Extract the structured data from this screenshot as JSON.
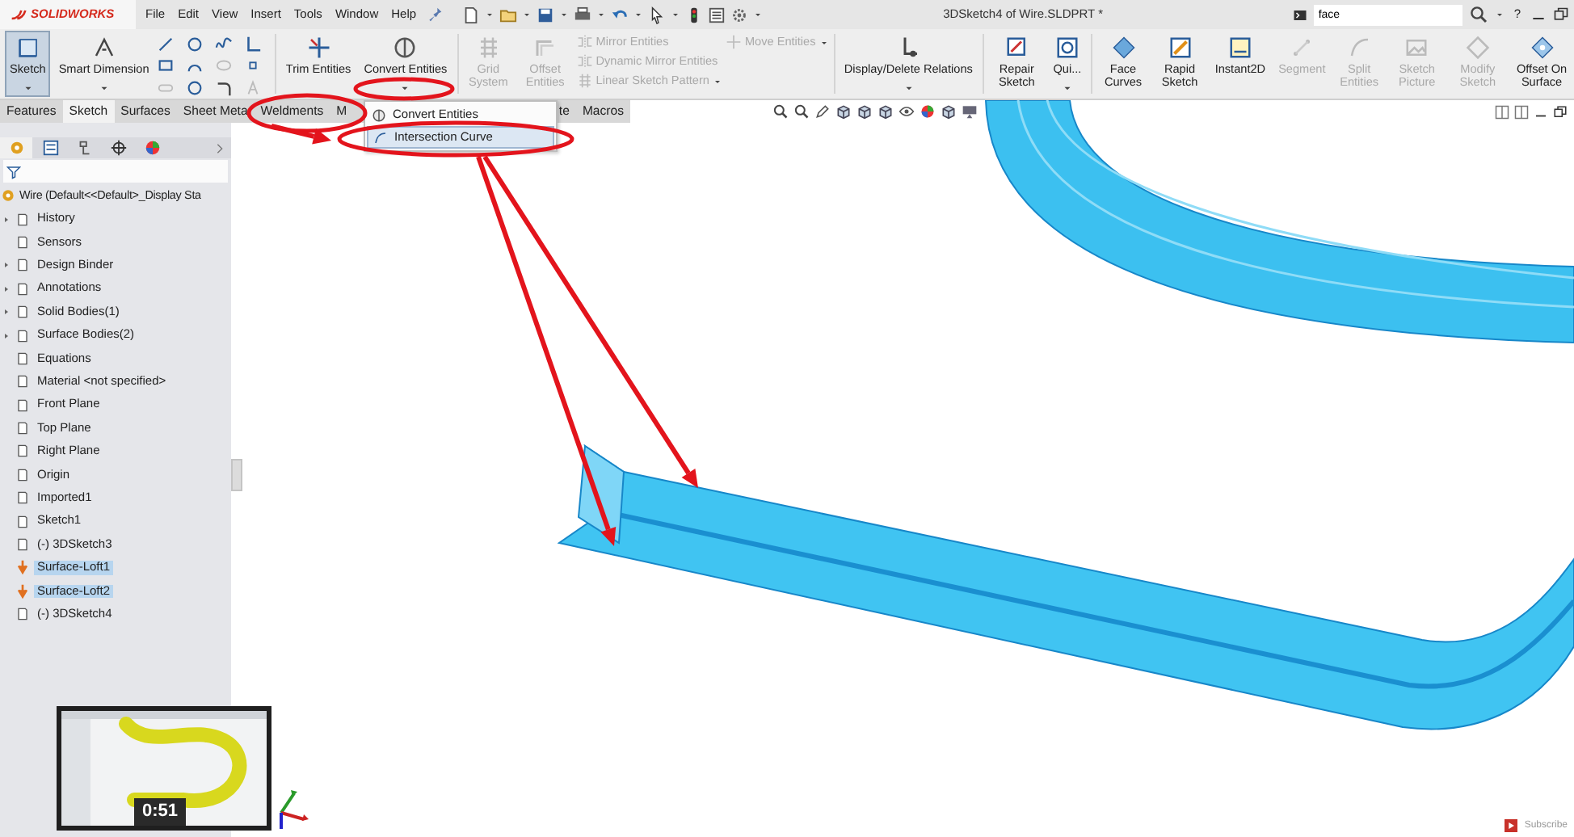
{
  "title_bar": {
    "logo": "SOLIDWORKS",
    "menu": [
      {
        "label": "File"
      },
      {
        "label": "Edit"
      },
      {
        "label": "View"
      },
      {
        "label": "Insert"
      },
      {
        "label": "Tools"
      },
      {
        "label": "Window"
      },
      {
        "label": "Help"
      }
    ],
    "document_title": "3DSketch4 of Wire.SLDPRT *",
    "search": {
      "value": "face"
    },
    "help": "?"
  },
  "ribbon": [
    {
      "kind": "wide",
      "label": "Sketch",
      "selected": true,
      "disabled": false,
      "dropdown": true
    },
    {
      "kind": "wide",
      "label": "Smart Dimension",
      "selected": false,
      "disabled": false,
      "dropdown": true
    },
    {
      "kind": "icons"
    },
    {
      "kind": "wide",
      "label": "Trim Entities",
      "selected": false,
      "disabled": false,
      "dropdown": false
    },
    {
      "kind": "wide",
      "label": "Convert Entities",
      "selected": false,
      "disabled": false,
      "dropdown": true
    },
    {
      "kind": "narrow",
      "label": "Grid System",
      "selected": false,
      "disabled": true,
      "dropdown": false
    },
    {
      "kind": "narrow",
      "label": "Offset Entities",
      "selected": false,
      "disabled": true,
      "dropdown": false
    },
    {
      "kind": "stack",
      "entries": [
        {
          "label": "Mirror Entities",
          "disabled": true
        },
        {
          "label": "Dynamic Mirror Entities",
          "disabled": true
        },
        {
          "label": "Linear Sketch Pattern",
          "disabled": true
        }
      ]
    },
    {
      "kind": "stack",
      "entries": [
        {
          "label": "Move Entities",
          "disabled": true
        }
      ]
    },
    {
      "kind": "wide",
      "label": "Display/Delete Relations",
      "selected": false,
      "disabled": false,
      "dropdown": true
    },
    {
      "kind": "narrow",
      "label": "Repair Sketch",
      "selected": false,
      "disabled": false,
      "dropdown": false
    },
    {
      "kind": "narrow",
      "label": "Qui...",
      "selected": false,
      "disabled": false,
      "dropdown": true
    },
    {
      "kind": "narrow",
      "label": "Face Curves",
      "selected": false,
      "disabled": false,
      "dropdown": false
    },
    {
      "kind": "narrow",
      "label": "Rapid Sketch",
      "selected": false,
      "disabled": false,
      "dropdown": false
    },
    {
      "kind": "narrow",
      "label": "Instant2D",
      "selected": false,
      "disabled": false,
      "dropdown": false
    },
    {
      "kind": "narrow",
      "label": "Segment",
      "selected": false,
      "disabled": true,
      "dropdown": false
    },
    {
      "kind": "narrow",
      "label": "Split Entities",
      "selected": false,
      "disabled": true,
      "dropdown": false
    },
    {
      "kind": "narrow",
      "label": "Sketch Picture",
      "selected": false,
      "disabled": true,
      "dropdown": false
    },
    {
      "kind": "narrow",
      "label": "Modify Sketch",
      "selected": false,
      "disabled": true,
      "dropdown": false
    },
    {
      "kind": "narrow",
      "label": "Offset On Surface",
      "selected": false,
      "disabled": false,
      "dropdown": false
    }
  ],
  "tabs": {
    "before_menu": [
      {
        "label": "Features",
        "selected": false
      },
      {
        "label": "Sketch",
        "selected": true
      },
      {
        "label": "Surfaces",
        "selected": false
      },
      {
        "label": "Sheet Meta",
        "selected": false
      },
      {
        "label": "Weldments",
        "selected": false
      },
      {
        "label": "M",
        "selected": false
      }
    ],
    "after_menu": [
      {
        "label": "te",
        "selected": false
      },
      {
        "label": "Macros",
        "selected": false
      }
    ]
  },
  "panel_tabs": [
    {
      "selected": true
    },
    {
      "selected": false
    },
    {
      "selected": false
    },
    {
      "selected": false
    },
    {
      "selected": false
    }
  ],
  "dropdown_menu": [
    {
      "label": "Convert Entities",
      "selected": false
    },
    {
      "label": "Intersection Curve",
      "selected": true
    }
  ],
  "feature_tree": {
    "root": "Wire  (Default<<Default>_Display Sta",
    "items": [
      {
        "label": "History",
        "collapsed": true,
        "selected": false
      },
      {
        "label": "Sensors",
        "collapsed": false,
        "selected": false
      },
      {
        "label": "Design Binder",
        "collapsed": true,
        "selected": false
      },
      {
        "label": "Annotations",
        "collapsed": true,
        "selected": false
      },
      {
        "label": "Solid Bodies(1)",
        "collapsed": true,
        "selected": false
      },
      {
        "label": "Surface Bodies(2)",
        "collapsed": true,
        "selected": false
      },
      {
        "label": "Equations",
        "collapsed": false,
        "selected": false
      },
      {
        "label": "Material <not specified>",
        "collapsed": false,
        "selected": false
      },
      {
        "label": "Front Plane",
        "collapsed": false,
        "selected": false
      },
      {
        "label": "Top Plane",
        "collapsed": false,
        "selected": false
      },
      {
        "label": "Right Plane",
        "collapsed": false,
        "selected": false
      },
      {
        "label": "Origin",
        "collapsed": false,
        "selected": false
      },
      {
        "label": "Imported1",
        "collapsed": false,
        "selected": false
      },
      {
        "label": "Sketch1",
        "collapsed": false,
        "selected": false
      },
      {
        "label": "(-) 3DSketch3",
        "collapsed": false,
        "selected": false
      },
      {
        "label": "Surface-Loft1",
        "collapsed": false,
        "selected": true
      },
      {
        "label": "Surface-Loft2",
        "collapsed": false,
        "selected": true
      },
      {
        "label": "(-) 3DSketch4",
        "collapsed": false,
        "selected": false
      }
    ]
  },
  "video_overlay": {
    "time": "0:51",
    "subscribe": "Subscribe"
  }
}
